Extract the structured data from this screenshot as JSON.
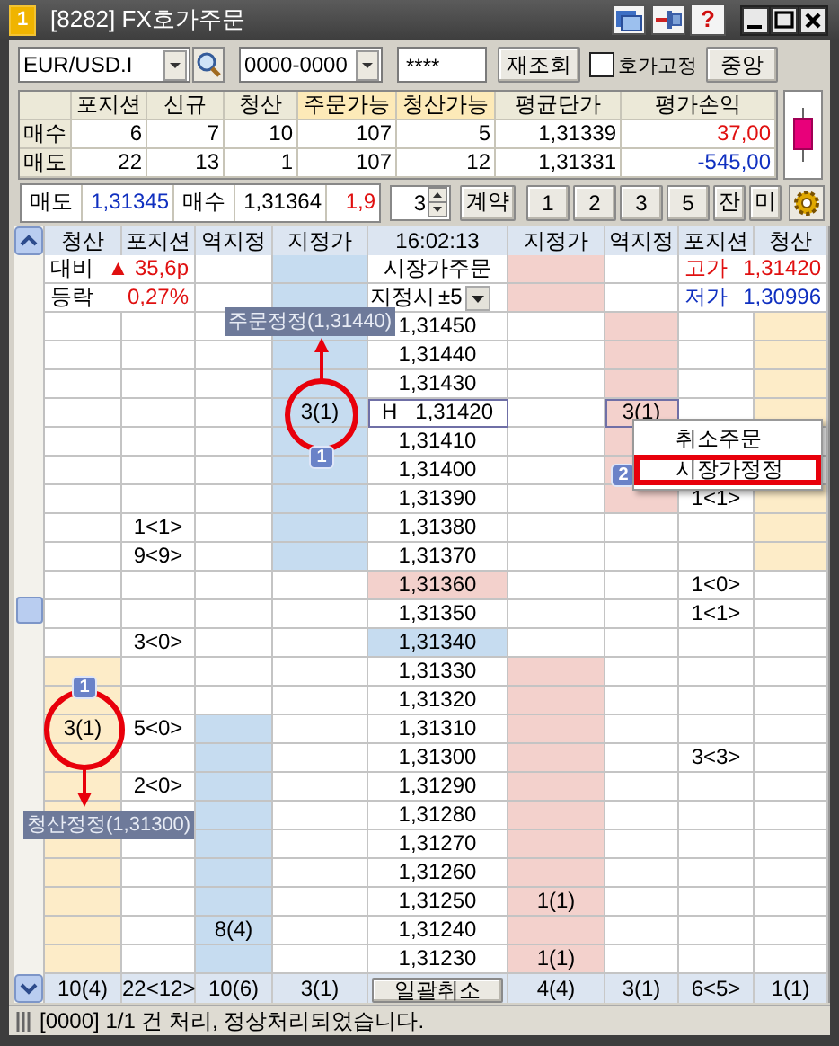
{
  "window": {
    "badge": "1",
    "title": "[8282] FX호가주문",
    "help": "?"
  },
  "toolbar": {
    "symbol": "EUR/USD.I",
    "account": "0000-0000",
    "password": "****",
    "refresh_button": "재조회",
    "lock_quotes": {
      "label": "호가고정",
      "checked": false
    },
    "center_button": "중앙"
  },
  "summary": {
    "columns": [
      {
        "label": "포지션",
        "highlighted": false
      },
      {
        "label": "신규",
        "highlighted": false
      },
      {
        "label": "청산",
        "highlighted": false
      },
      {
        "label": "주문가능",
        "highlighted": true
      },
      {
        "label": "청산가능",
        "highlighted": true
      },
      {
        "label": "평균단가",
        "highlighted": false
      },
      {
        "label": "평가손익",
        "highlighted": false
      }
    ],
    "rows": [
      {
        "label": "매수",
        "color": "#e01010",
        "values": [
          "6",
          "7",
          "10",
          "107",
          "5",
          "1,31339",
          "37,00"
        ]
      },
      {
        "label": "매도",
        "color": "#1030c0",
        "values": [
          "22",
          "13",
          "1",
          "107",
          "12",
          "1,31331",
          "-545,00"
        ]
      }
    ]
  },
  "quote": {
    "bid_label": "매도",
    "bid": "1,31345",
    "ask_label": "매수",
    "ask": "1,31364",
    "spread": "1,9",
    "quantity": "3",
    "unit_button": "계약",
    "presets": [
      "1",
      "2",
      "3",
      "5"
    ],
    "buttons": [
      "잔",
      "미"
    ]
  },
  "book": {
    "columns": [
      "청산",
      "포지션",
      "역지정",
      "지정가",
      "16:02:13",
      "지정가",
      "역지정",
      "포지션",
      "청산"
    ],
    "left_stats": [
      {
        "label": "대비",
        "value": "▲ 35,6p",
        "color": "#e01010"
      },
      {
        "label": "등락",
        "value": "0,27%",
        "color": "#e01010"
      }
    ],
    "right_stats": [
      {
        "label": "고가",
        "value": "1,31420",
        "color": "#e01010"
      },
      {
        "label": "저가",
        "value": "1,30996",
        "color": "#1030c0"
      }
    ],
    "market_order": "시장가주문",
    "limit_label": "지정시",
    "limit_offset": "±5",
    "rows": [
      {
        "cells": [
          {},
          {},
          {},
          {
            "color": "#c6dcf0"
          },
          {
            "text": "1,31450"
          },
          {},
          {
            "color": "#f3d1cc"
          },
          {},
          {
            "color": "#fdecc8"
          }
        ]
      },
      {
        "cells": [
          {},
          {},
          {},
          {
            "color": "#c6dcf0"
          },
          {
            "text": "1,31440"
          },
          {},
          {
            "color": "#f3d1cc"
          },
          {},
          {
            "color": "#fdecc8"
          }
        ]
      },
      {
        "cells": [
          {},
          {},
          {},
          {
            "color": "#c6dcf0"
          },
          {
            "text": "1,31430"
          },
          {},
          {
            "color": "#f3d1cc"
          },
          {},
          {
            "color": "#fdecc8"
          }
        ]
      },
      {
        "cells": [
          {},
          {},
          {},
          {
            "color": "#c6dcf0",
            "text": "3(1)"
          },
          {
            "text": "1,31420",
            "flag": "H",
            "outlined": true
          },
          {},
          {
            "color": "#f3d1cc",
            "text": "3(1)",
            "outlined": true
          },
          {},
          {
            "color": "#fdecc8"
          }
        ]
      },
      {
        "cells": [
          {},
          {},
          {},
          {
            "color": "#c6dcf0"
          },
          {
            "text": "1,31410"
          },
          {},
          {
            "color": "#f3d1cc"
          },
          {},
          {}
        ]
      },
      {
        "cells": [
          {},
          {},
          {},
          {
            "color": "#c6dcf0"
          },
          {
            "text": "1,31400"
          },
          {},
          {
            "color": "#f3d1cc"
          },
          {},
          {}
        ]
      },
      {
        "cells": [
          {},
          {},
          {},
          {
            "color": "#c6dcf0"
          },
          {
            "text": "1,31390"
          },
          {},
          {
            "color": "#f3d1cc"
          },
          {
            "text": "1<1>"
          },
          {
            "color": "#fdecc8"
          }
        ]
      },
      {
        "cells": [
          {},
          {
            "text": "1<1>"
          },
          {},
          {
            "color": "#c6dcf0"
          },
          {
            "text": "1,31380"
          },
          {},
          {},
          {},
          {
            "color": "#fdecc8"
          }
        ]
      },
      {
        "cells": [
          {},
          {
            "text": "9<9>"
          },
          {},
          {
            "color": "#c6dcf0"
          },
          {
            "text": "1,31370"
          },
          {},
          {},
          {},
          {
            "color": "#fdecc8"
          }
        ]
      },
      {
        "cells": [
          {},
          {},
          {},
          {},
          {
            "text": "1,31360",
            "color": "#f3d1cc"
          },
          {},
          {},
          {
            "text": "1<0>"
          },
          {}
        ]
      },
      {
        "cells": [
          {},
          {},
          {},
          {},
          {
            "text": "1,31350"
          },
          {},
          {},
          {
            "text": "1<1>"
          },
          {}
        ]
      },
      {
        "cells": [
          {},
          {
            "text": "3<0>"
          },
          {},
          {},
          {
            "text": "1,31340",
            "color": "#c6dcf0"
          },
          {},
          {},
          {},
          {}
        ]
      },
      {
        "cells": [
          {
            "color": "#fdecc8"
          },
          {},
          {},
          {},
          {
            "text": "1,31330"
          },
          {
            "color": "#f3d1cc"
          },
          {},
          {},
          {}
        ]
      },
      {
        "cells": [
          {
            "color": "#fdecc8"
          },
          {},
          {},
          {},
          {
            "text": "1,31320"
          },
          {
            "color": "#f3d1cc"
          },
          {},
          {},
          {}
        ]
      },
      {
        "cells": [
          {
            "color": "#fdecc8",
            "text": "3(1)"
          },
          {
            "text": "5<0>"
          },
          {
            "color": "#c6dcf0"
          },
          {},
          {
            "text": "1,31310"
          },
          {
            "color": "#f3d1cc"
          },
          {},
          {},
          {}
        ]
      },
      {
        "cells": [
          {
            "color": "#fdecc8"
          },
          {},
          {
            "color": "#c6dcf0"
          },
          {},
          {
            "text": "1,31300"
          },
          {
            "color": "#f3d1cc"
          },
          {},
          {
            "text": "3<3>"
          },
          {}
        ]
      },
      {
        "cells": [
          {
            "color": "#fdecc8"
          },
          {
            "text": "2<0>"
          },
          {
            "color": "#c6dcf0"
          },
          {},
          {
            "text": "1,31290"
          },
          {
            "color": "#f3d1cc"
          },
          {},
          {},
          {}
        ]
      },
      {
        "cells": [
          {
            "color": "#fdecc8"
          },
          {},
          {
            "color": "#c6dcf0"
          },
          {},
          {
            "text": "1,31280"
          },
          {
            "color": "#f3d1cc"
          },
          {},
          {},
          {}
        ]
      },
      {
        "cells": [
          {
            "color": "#fdecc8"
          },
          {},
          {
            "color": "#c6dcf0"
          },
          {},
          {
            "text": "1,31270"
          },
          {
            "color": "#f3d1cc"
          },
          {},
          {},
          {}
        ]
      },
      {
        "cells": [
          {
            "color": "#fdecc8"
          },
          {},
          {
            "color": "#c6dcf0"
          },
          {},
          {
            "text": "1,31260"
          },
          {
            "color": "#f3d1cc"
          },
          {},
          {},
          {}
        ]
      },
      {
        "cells": [
          {
            "color": "#fdecc8"
          },
          {},
          {
            "color": "#c6dcf0"
          },
          {},
          {
            "text": "1,31250"
          },
          {
            "color": "#f3d1cc",
            "text": "1(1)"
          },
          {},
          {},
          {}
        ]
      },
      {
        "cells": [
          {
            "color": "#fdecc8"
          },
          {},
          {
            "color": "#c6dcf0",
            "text": "8(4)"
          },
          {},
          {
            "text": "1,31240"
          },
          {
            "color": "#f3d1cc"
          },
          {},
          {},
          {}
        ]
      },
      {
        "cells": [
          {
            "color": "#fdecc8"
          },
          {},
          {
            "color": "#c6dcf0"
          },
          {},
          {
            "text": "1,31230"
          },
          {
            "color": "#f3d1cc",
            "text": "1(1)"
          },
          {},
          {},
          {}
        ]
      }
    ],
    "totals": [
      "10(4)",
      "22<12>",
      "10(6)",
      "3(1)",
      "일괄취소",
      "4(4)",
      "3(1)",
      "6<5>",
      "1(1)"
    ]
  },
  "annotations": [
    {
      "badge": "1",
      "label": "주문정정(1,31440)"
    },
    {
      "badge": "1",
      "label": "청산정정(1,31300)"
    }
  ],
  "context_menu": {
    "badge": "2",
    "items": [
      {
        "label": "취소주문",
        "highlighted": false
      },
      {
        "label": "시장가정정",
        "highlighted": true
      }
    ]
  },
  "status_bar": {
    "message": "[0000] 1/1 건 처리, 정상처리되었습니다."
  }
}
